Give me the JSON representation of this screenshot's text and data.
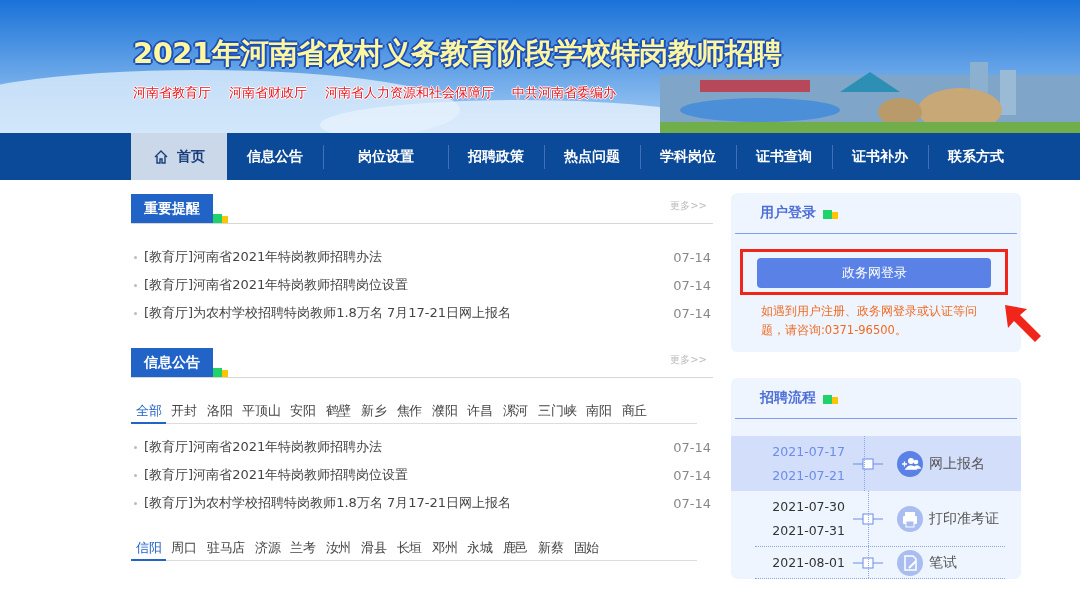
{
  "header": {
    "title": "2021年河南省农村义务教育阶段学校特岗教师招聘",
    "organizers": [
      "河南省教育厅",
      "河南省财政厅",
      "河南省人力资源和社会保障厅",
      "中共河南省委编办"
    ]
  },
  "nav": [
    {
      "label": "首页",
      "selected": true
    },
    {
      "label": "信息公告",
      "selected": false
    },
    {
      "label": "岗位设置",
      "selected": false
    },
    {
      "label": "招聘政策",
      "selected": false
    },
    {
      "label": "热点问题",
      "selected": false
    },
    {
      "label": "学科岗位",
      "selected": false
    },
    {
      "label": "证书查询",
      "selected": false
    },
    {
      "label": "证书补办",
      "selected": false
    },
    {
      "label": "联系方式",
      "selected": false
    }
  ],
  "reminders": {
    "title": "重要提醒",
    "more": "更多>>",
    "items": [
      {
        "text": "[教育厅]河南省2021年特岗教师招聘办法",
        "date": "07-14"
      },
      {
        "text": "[教育厅]河南省2021年特岗教师招聘岗位设置",
        "date": "07-14"
      },
      {
        "text": "[教育厅]为农村学校招聘特岗教师1.8万名 7月17-21日网上报名",
        "date": "07-14"
      }
    ]
  },
  "announcements": {
    "title": "信息公告",
    "more": "更多>>",
    "region_tabs": [
      {
        "label": "全部",
        "selected": true
      },
      {
        "label": "开封",
        "selected": false
      },
      {
        "label": "洛阳",
        "selected": false
      },
      {
        "label": "平顶山",
        "selected": false
      },
      {
        "label": "安阳",
        "selected": false
      },
      {
        "label": "鹤壁",
        "selected": false
      },
      {
        "label": "新乡",
        "selected": false
      },
      {
        "label": "焦作",
        "selected": false
      },
      {
        "label": "濮阳",
        "selected": false
      },
      {
        "label": "许昌",
        "selected": false
      },
      {
        "label": "漯河",
        "selected": false
      },
      {
        "label": "三门峡",
        "selected": false
      },
      {
        "label": "南阳",
        "selected": false
      },
      {
        "label": "商丘",
        "selected": false
      }
    ],
    "items": [
      {
        "text": "[教育厅]河南省2021年特岗教师招聘办法",
        "date": "07-14"
      },
      {
        "text": "[教育厅]河南省2021年特岗教师招聘岗位设置",
        "date": "07-14"
      },
      {
        "text": "[教育厅]为农村学校招聘特岗教师1.8万名 7月17-21日网上报名",
        "date": "07-14"
      }
    ],
    "region_tabs_2": [
      {
        "label": "信阳",
        "selected": true
      },
      {
        "label": "周口",
        "selected": false
      },
      {
        "label": "驻马店",
        "selected": false
      },
      {
        "label": "济源",
        "selected": false
      },
      {
        "label": "兰考",
        "selected": false
      },
      {
        "label": "汝州",
        "selected": false
      },
      {
        "label": "滑县",
        "selected": false
      },
      {
        "label": "长垣",
        "selected": false
      },
      {
        "label": "邓州",
        "selected": false
      },
      {
        "label": "永城",
        "selected": false
      },
      {
        "label": "鹿邑",
        "selected": false
      },
      {
        "label": "新蔡",
        "selected": false
      },
      {
        "label": "固始",
        "selected": false
      }
    ]
  },
  "login": {
    "title": "用户登录",
    "button": "政务网登录",
    "highlighted": true,
    "pointer_arrow": true,
    "note": "如遇到用户注册、政务网登录或认证等问题，请咨询:0371-96500。"
  },
  "process": {
    "title": "招聘流程",
    "steps": [
      {
        "kind": "signup",
        "dates": [
          "2021-07-17",
          "2021-07-21"
        ],
        "label": "网上报名",
        "selected": true
      },
      {
        "kind": "print",
        "dates": [
          "2021-07-30",
          "2021-07-31"
        ],
        "label": "打印准考证",
        "selected": false
      },
      {
        "kind": "exam",
        "dates": [
          "2021-08-01"
        ],
        "label": "笔试",
        "selected": false
      }
    ]
  }
}
